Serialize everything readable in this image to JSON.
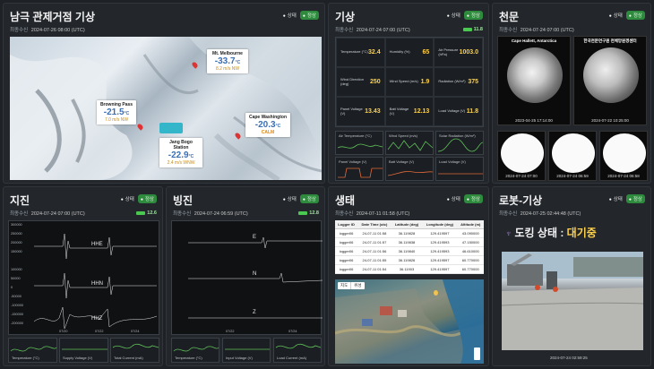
{
  "antarctica": {
    "title": "남극 관제거점 기상",
    "last_label": "최종수신",
    "last_time": "2024-07-26 08:00 (UTC)",
    "status_label": "상태",
    "normal_label": "정상",
    "stations": [
      {
        "name": "Mt. Melbourne",
        "temp": "-33.7",
        "unit": "°C",
        "wind": "8.2 m/s NW",
        "extra": ""
      },
      {
        "name": "Browning Pass",
        "temp": "-21.5",
        "unit": "°C",
        "wind": "7.0 m/s NW",
        "extra": ""
      },
      {
        "name": "Cape Washington",
        "temp": "-20.3",
        "unit": "°C",
        "wind": "CALM",
        "extra": ""
      },
      {
        "name": "Jang Bogo Station",
        "temp": "-22.9",
        "unit": "°C",
        "wind": "2.4 m/s WNW",
        "extra": ""
      }
    ]
  },
  "weather": {
    "title": "기상",
    "last_label": "최종수신",
    "last_time": "2024-07-24 07:00 (UTC)",
    "status_label": "상태",
    "normal_label": "정상",
    "battery": "11.8",
    "cells": [
      {
        "label": "Temperature (°C)",
        "value": "32.4"
      },
      {
        "label": "Humidity (%)",
        "value": "65"
      },
      {
        "label": "Air Pressure (hPa)",
        "value": "1003.0"
      },
      {
        "label": "Wind Direction (deg)",
        "value": "250"
      },
      {
        "label": "Wind Speed (m/s)",
        "value": "1.9"
      },
      {
        "label": "Radiation (W/m²)",
        "value": "375"
      },
      {
        "label": "Panel Voltage (V)",
        "value": "13.43"
      },
      {
        "label": "Batt Voltage (V)",
        "value": "12.13"
      },
      {
        "label": "Load Voltage (V)",
        "value": "11.8"
      }
    ],
    "minis": [
      "Air Temperature (°C)",
      "Wind Speed (m/s)",
      "Solar Radiation (W/m²)",
      "Panel Voltage (V)",
      "Batt Voltage (V)",
      "Load Voltage (V)"
    ]
  },
  "sky": {
    "title": "천문",
    "last_label": "최종수신",
    "last_time": "2024-07-24 07:00 (UTC)",
    "status_label": "상태",
    "normal_label": "정상",
    "cam1_label": "Cape Hallett, Antarctica",
    "cam1_time": "2023-04-25 17:14:00",
    "cam2_label": "한국천문연구원 천체망원경센터",
    "cam2_time": "2024-07-22 10:25:00",
    "cam3_time": "2024-07-24 07:00",
    "cam4_time": "2024-07-24 06:59",
    "cam5_time": "2024-07-24 06:58"
  },
  "seismic": {
    "title": "지진",
    "last_label": "최종수신",
    "last_time": "2024-07-24 07:00 (UTC)",
    "status_label": "상태",
    "normal_label": "정상",
    "battery": "12.6",
    "channels": [
      "HHE",
      "HHN",
      "HHZ"
    ],
    "yticks": [
      "300000",
      "250000",
      "200000",
      "150000",
      "100000",
      "50000",
      "0",
      "-50000",
      "-100000",
      "-150000",
      "-200000",
      "-250000",
      "-300000"
    ],
    "xticks": [
      "07/20",
      "07/22",
      "07/24"
    ],
    "minis": [
      "Temperature (°C)",
      "Supply Voltage (V)",
      "Total Current (mA)"
    ]
  },
  "glacier": {
    "title": "빙진",
    "last_label": "최종수신",
    "last_time": "2024-07-24 06:59 (UTC)",
    "status_label": "상태",
    "normal_label": "정상",
    "battery": "12.8",
    "channels": [
      "E",
      "N",
      "Z"
    ],
    "xticks": [
      "07/22",
      "07/24"
    ],
    "minis": [
      "Temperature (°C)",
      "Input Voltage (V)",
      "Load Current (mA)"
    ]
  },
  "ecology": {
    "title": "생태",
    "last_label": "최종수신",
    "last_time": "2024-07-11 01:58 (UTC)",
    "status_label": "상태",
    "normal_label": "정상",
    "columns": [
      "Logger ID",
      "Date Time (utc)",
      "Latitude (deg)",
      "Longitude (deg)",
      "Altitude (m)"
    ],
    "rows": [
      [
        "logger06",
        "24-07-11 01:58",
        "36.119828",
        "129.419597",
        "43.090000"
      ],
      [
        "logger06",
        "24-07-11 01:57",
        "36.119838",
        "129.419593",
        "47.150000"
      ],
      [
        "logger06",
        "24-07-11 01:56",
        "36.119840",
        "129.419593",
        "46.610000"
      ],
      [
        "logger06",
        "24-07-11 01:55",
        "36.119826",
        "129.419597",
        "60.770000"
      ],
      [
        "logger06",
        "24-07-11 01:54",
        "36.11903",
        "129.419597",
        "60.770000"
      ]
    ],
    "map_btn1": "지도",
    "map_btn2": "위성"
  },
  "robot": {
    "title": "로봇-기상",
    "last_label": "최종수신",
    "last_time": "2024-07-25 02:44:48 (UTC)",
    "status_label": "상태",
    "normal_label": "정상",
    "docking_label": "도킹 상태 :",
    "docking_value": "대기중",
    "image_time": "2024-07-24 02:59:25"
  }
}
